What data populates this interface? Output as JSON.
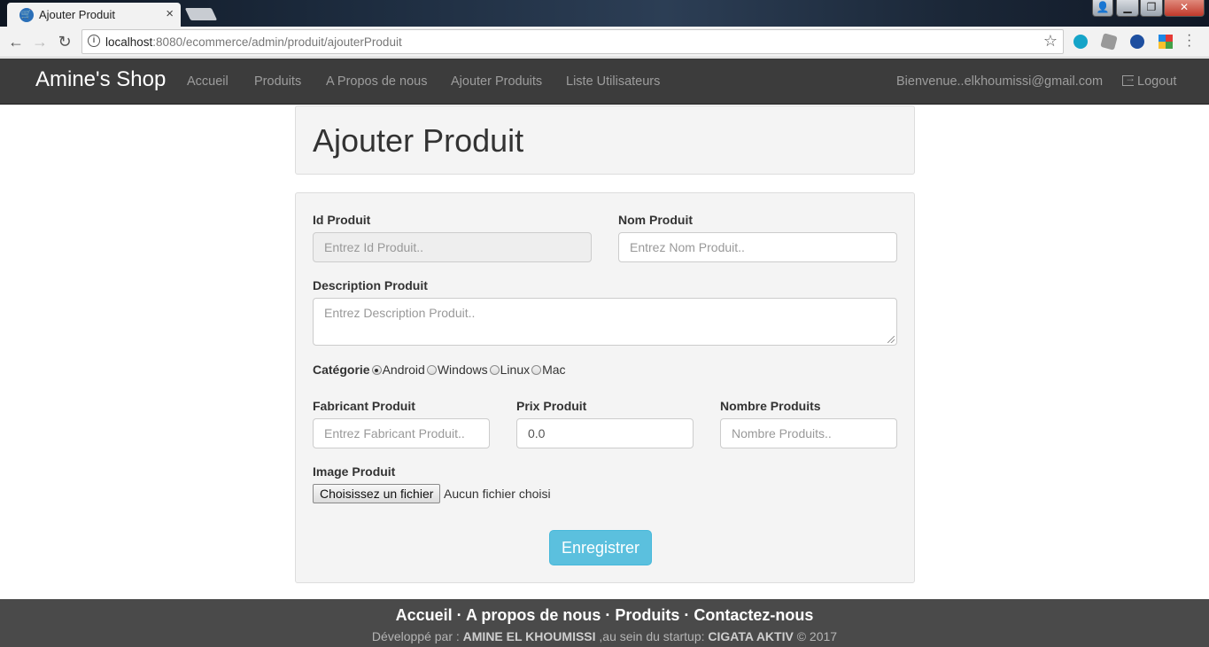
{
  "browser": {
    "tab_title": "Ajouter Produit",
    "url_host": "localhost",
    "url_rest": ":8080/ecommerce/admin/produit/ajouterProduit"
  },
  "navbar": {
    "brand": "Amine's Shop",
    "links": [
      "Accueil",
      "Produits",
      "A Propos de nous",
      "Ajouter Produits",
      "Liste Utilisateurs"
    ],
    "welcome": "Bienvenue..elkhoumissi@gmail.com",
    "logout": "Logout"
  },
  "page": {
    "title": "Ajouter Produit"
  },
  "form": {
    "id_label": "Id Produit",
    "id_placeholder": "Entrez Id Produit..",
    "nom_label": "Nom Produit",
    "nom_placeholder": "Entrez Nom Produit..",
    "desc_label": "Description Produit",
    "desc_placeholder": "Entrez Description Produit..",
    "categorie_label": "Catégorie",
    "categories": [
      "Android",
      "Windows",
      "Linux",
      "Mac"
    ],
    "categorie_selected": "Android",
    "fabricant_label": "Fabricant Produit",
    "fabricant_placeholder": "Entrez Fabricant Produit..",
    "prix_label": "Prix Produit",
    "prix_value": "0.0",
    "nombre_label": "Nombre Produits",
    "nombre_placeholder": "Nombre Produits..",
    "image_label": "Image Produit",
    "file_button": "Choisissez un fichier",
    "file_status": "Aucun fichier choisi",
    "submit": "Enregistrer"
  },
  "footer": {
    "links": [
      "Accueil",
      "A propos de nous",
      "Produits",
      "Contactez-nous"
    ],
    "separator": " · ",
    "credit_prefix": "Développé par : ",
    "author": "AMINE EL KHOUMISSI",
    "credit_middle": " ,au sein du startup: ",
    "startup": "CIGATA AKTIV",
    "credit_suffix": " © 2017"
  },
  "colors": {
    "navbar_bg": "#3c3c3c",
    "panel_bg": "#f4f4f4",
    "button_info": "#5bc0de",
    "footer_bg": "#4a4a4a"
  }
}
